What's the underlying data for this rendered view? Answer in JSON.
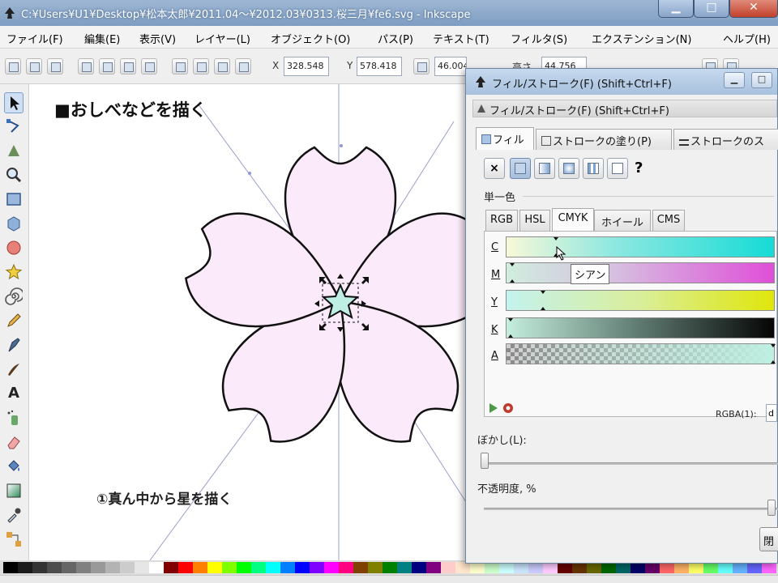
{
  "window": {
    "title": "C:¥Users¥U1¥Desktop¥松本太郎¥2011.04～¥2012.03¥0313.桜三月¥fe6.svg - Inkscape"
  },
  "menu": [
    "ファイル(F)",
    "編集(E)",
    "表示(V)",
    "レイヤー(L)",
    "オブジェクト(O)",
    "パス(P)",
    "テキスト(T)",
    "フィルタ(S)",
    "エクステンション(N)",
    "ヘルプ(H)"
  ],
  "toolbar": {
    "x_label": "X",
    "x_value": "328.548",
    "y_label": "Y",
    "y_value": "578.418",
    "w_label": "W",
    "w_value": "46.004",
    "h_label": "高さ",
    "h_value": "44.756"
  },
  "canvas": {
    "heading": "■おしべなどを描く",
    "step": "①真ん中から星を描く"
  },
  "dialog": {
    "title": "フィル/ストローク(F) (Shift+Ctrl+F)",
    "subtitle": "フィル/ストローク(F) (Shift+Ctrl+F)",
    "tabs": [
      "フィル",
      "ストロークの塗り(P)",
      "ストロークのス"
    ],
    "fill_mode_help": "?",
    "mode_none": "×",
    "group_label": "単一色",
    "color_tabs": [
      "RGB",
      "HSL",
      "CMYK",
      "ホイール",
      "CMS"
    ],
    "channels": [
      "C",
      "M",
      "Y",
      "K",
      "A"
    ],
    "tooltip": "シアン",
    "rgba_label": "RGBA(1):",
    "rgba_value": "d",
    "blur_label": "ぼかし(L):",
    "opacity_label": "不透明度, %",
    "close_label": "閉じる"
  },
  "colors": {
    "petal_fill": "#fbeafa",
    "star_fill": "#bfeee4",
    "accent": "#7c9ec9"
  }
}
